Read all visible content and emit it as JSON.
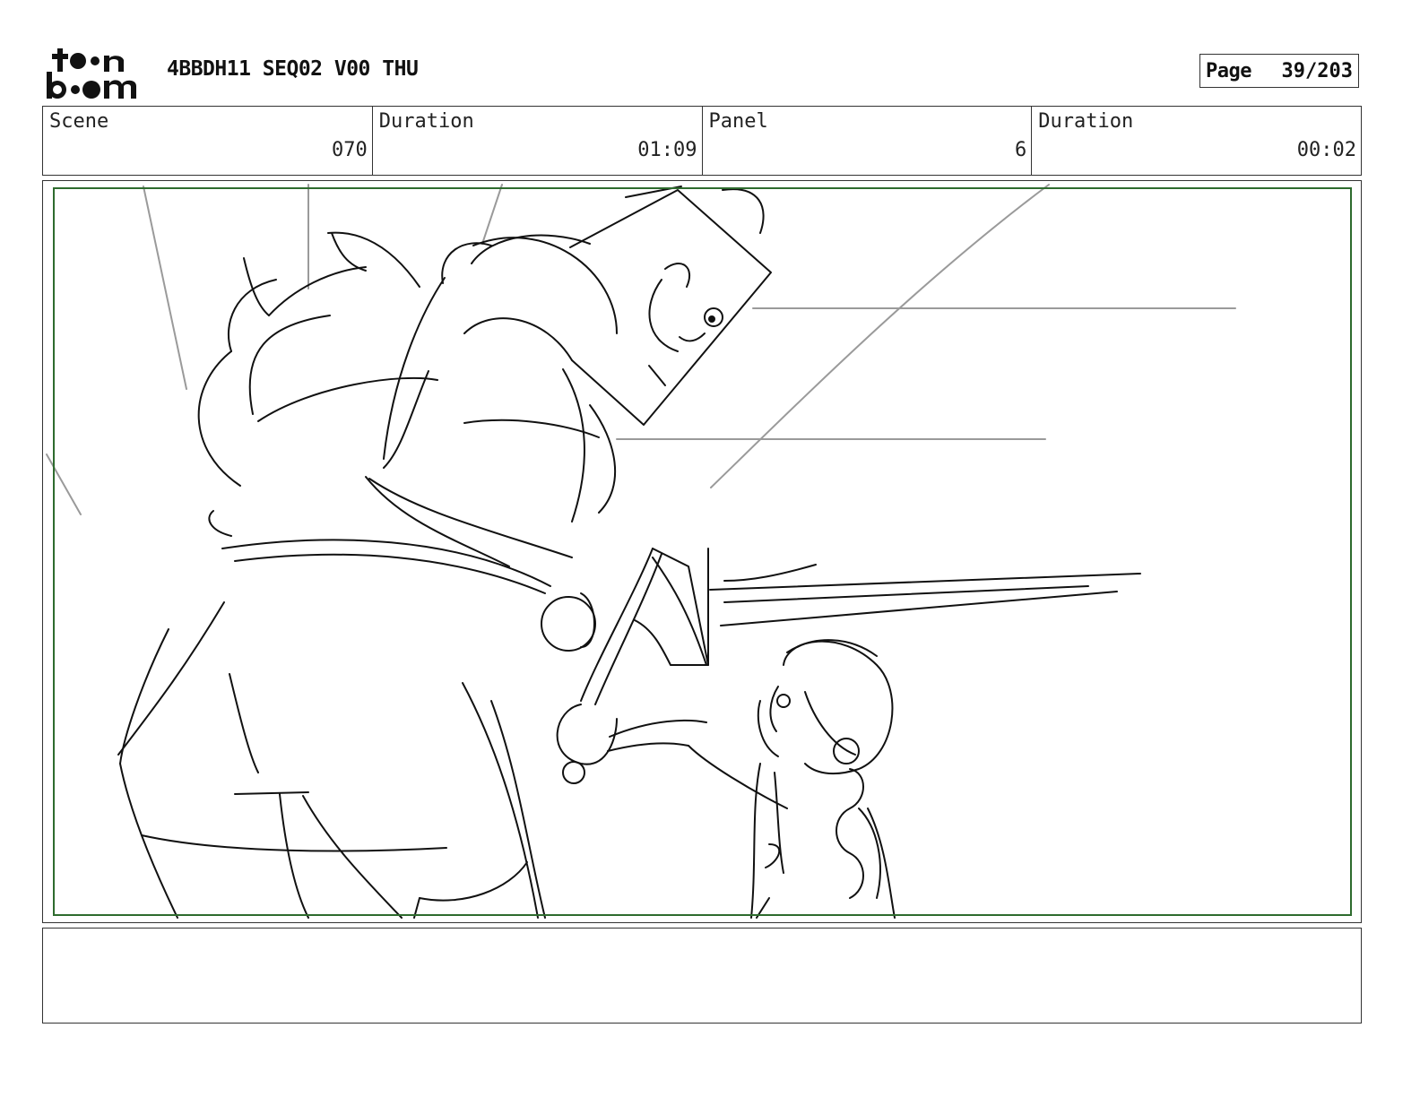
{
  "header": {
    "logo_text_top": "t●●n",
    "logo_text_bottom": "b●●m",
    "title": "4BBDH11 SEQ02 V00 THU",
    "page_label": "Page",
    "page_value": "39/203"
  },
  "info": {
    "scene_label": "Scene",
    "scene_value": "070",
    "duration_label": "Duration",
    "duration_value": "01:09",
    "panel_label": "Panel",
    "panel_value": "6",
    "panel_duration_label": "Duration",
    "panel_duration_value": "00:02"
  },
  "colors": {
    "safe_frame": "#2e6b2e",
    "sketch_line": "#111111",
    "guide_line": "#9a9a9a"
  },
  "notes": {
    "text": ""
  }
}
